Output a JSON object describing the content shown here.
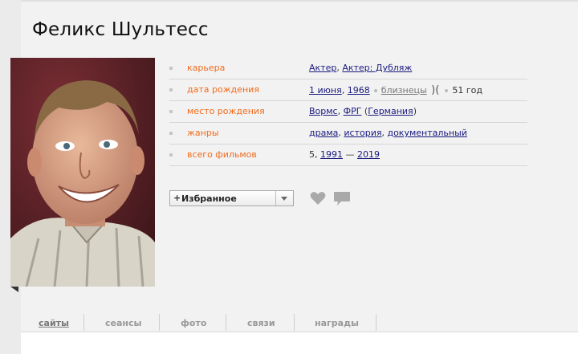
{
  "person": {
    "name": "Феликс Шультесс"
  },
  "info_rows": [
    {
      "label": "карьера"
    },
    {
      "label": "дата рождения"
    },
    {
      "label": "место рождения"
    },
    {
      "label": "жанры"
    },
    {
      "label": "всего фильмов"
    }
  ],
  "career": {
    "actor": "Актер",
    "dub": "Актер: Дубляж"
  },
  "birth": {
    "day": "1 июня",
    "year": "1968",
    "sign": "близнецы",
    "age": "51 год"
  },
  "place": {
    "city": "Вормс",
    "country": "ФРГ",
    "region": "Германия"
  },
  "genres": [
    "драма",
    "история",
    "документальный"
  ],
  "films": {
    "count": "5, ",
    "from": "1991",
    "dash": " — ",
    "to": "2019"
  },
  "favorites": {
    "plus": "+",
    "label": "Избранное"
  },
  "tabs": [
    "сайты",
    "сеансы",
    "фото",
    "связи",
    "награды"
  ],
  "colors": {
    "label": "#f26b1d",
    "link": "#1a1a80",
    "panel": "#f2f2f2"
  }
}
